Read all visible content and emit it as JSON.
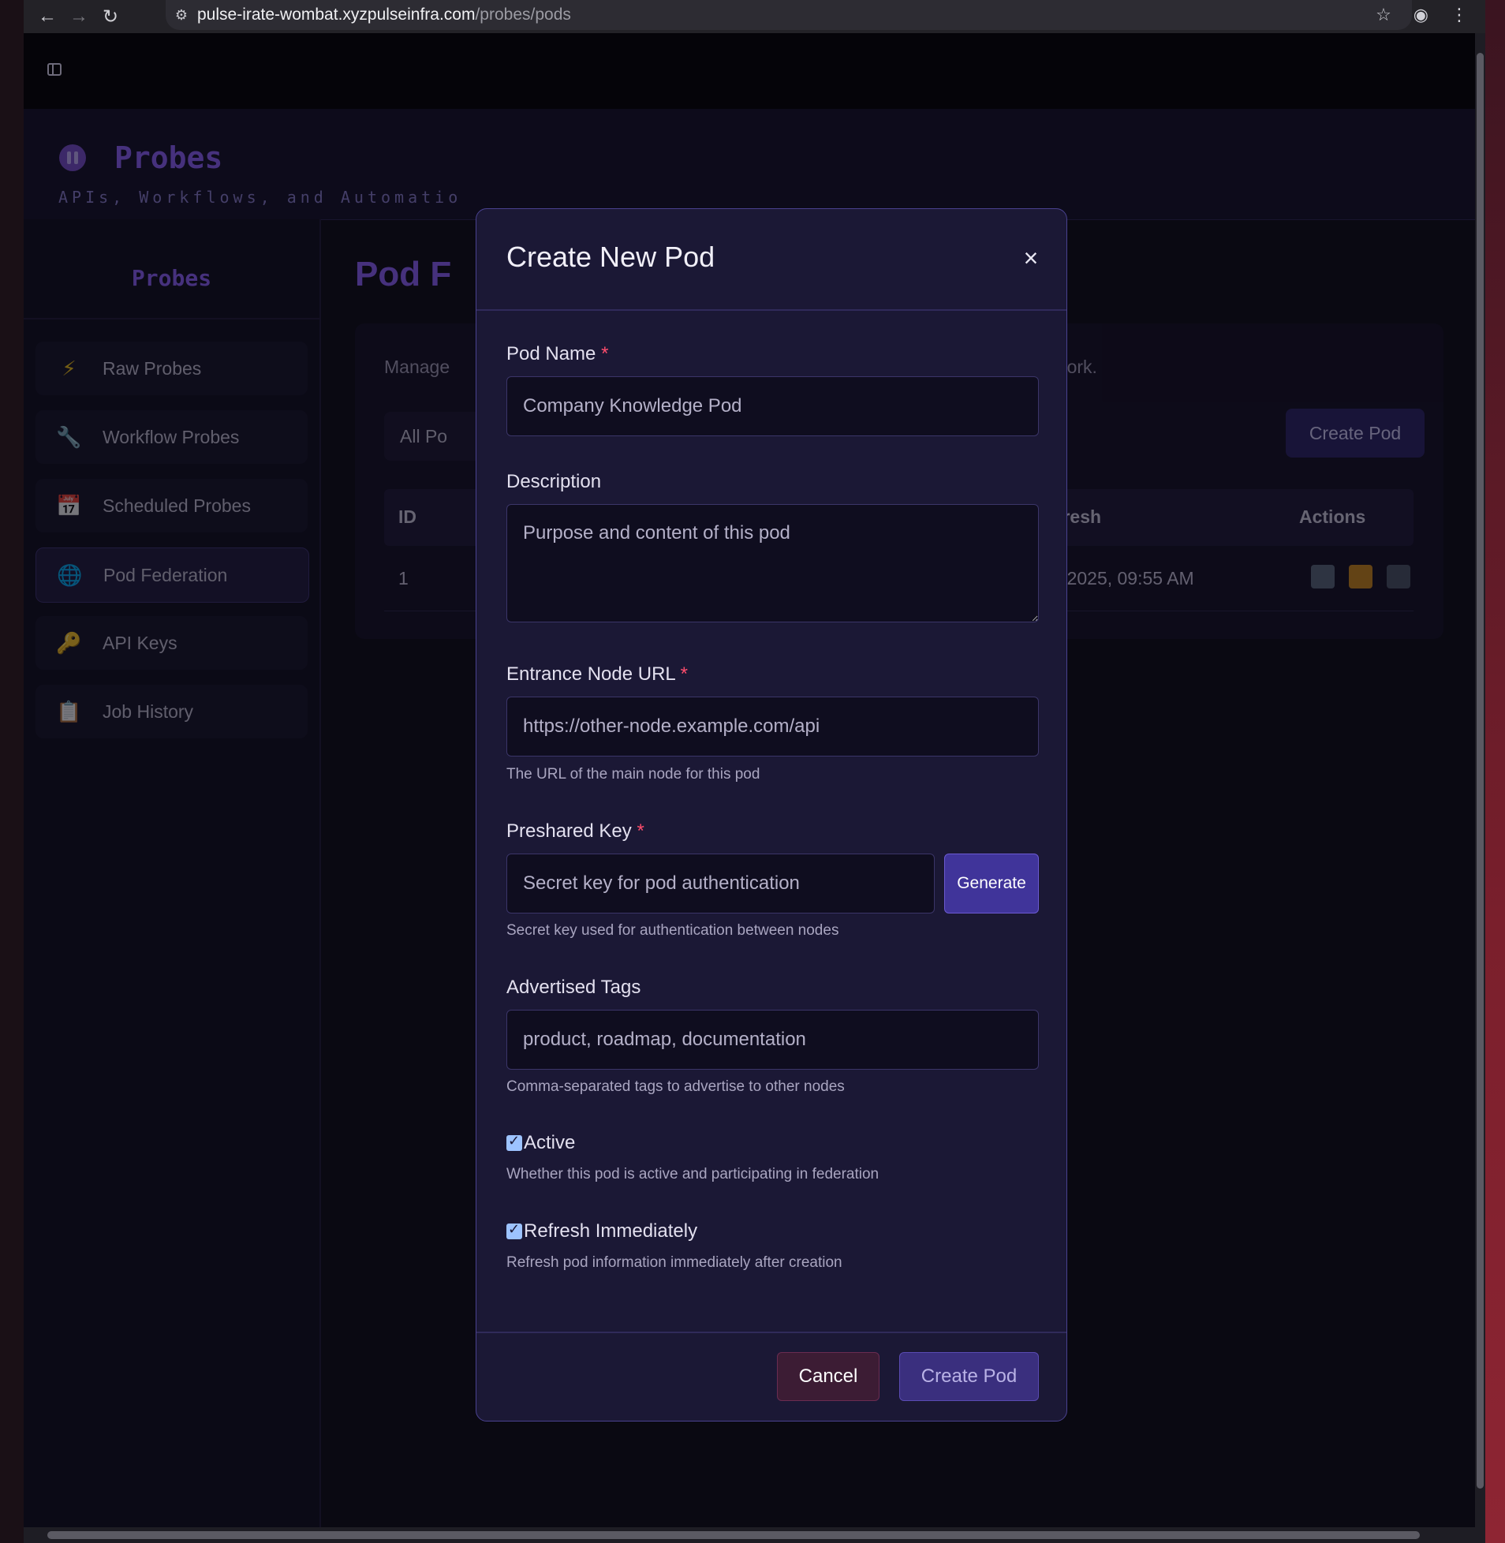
{
  "browser": {
    "url_host": "pulse-irate-wombat.xyzpulseinfra.com",
    "url_path": "/probes/pods"
  },
  "app": {
    "title": "Probes",
    "subtitle": "APIs, Workflows, and Automatio"
  },
  "sidebar": {
    "title": "Probes",
    "items": [
      {
        "label": "Raw Probes",
        "icon": "lightning-icon"
      },
      {
        "label": "Workflow Probes",
        "icon": "wrench-icon"
      },
      {
        "label": "Scheduled Probes",
        "icon": "calendar-icon"
      },
      {
        "label": "Pod Federation",
        "icon": "globe-icon",
        "active": true
      },
      {
        "label": "API Keys",
        "icon": "key-icon"
      },
      {
        "label": "Job History",
        "icon": "clipboard-icon"
      }
    ]
  },
  "main": {
    "title": "Pod F",
    "description_start": "Manage",
    "description_end": "work.",
    "filter_label": "All Po",
    "create_button": "Create Pod",
    "table": {
      "headers": {
        "id": "ID",
        "refresh": "efresh",
        "actions": "Actions"
      },
      "rows": [
        {
          "id": "1",
          "refresh": "5, 2025, 09:55 AM"
        }
      ]
    }
  },
  "modal": {
    "title": "Create New Pod",
    "close_symbol": "×",
    "pod_name": {
      "label": "Pod Name",
      "required_mark": "*",
      "placeholder": "Company Knowledge Pod"
    },
    "description": {
      "label": "Description",
      "placeholder": "Purpose and content of this pod"
    },
    "entrance_url": {
      "label": "Entrance Node URL",
      "required_mark": "*",
      "placeholder": "https://other-node.example.com/api",
      "hint": "The URL of the main node for this pod"
    },
    "preshared_key": {
      "label": "Preshared Key",
      "required_mark": "*",
      "placeholder": "Secret key for pod authentication",
      "generate_label": "Generate",
      "hint": "Secret key used for authentication between nodes"
    },
    "tags": {
      "label": "Advertised Tags",
      "placeholder": "product, roadmap, documentation",
      "hint": "Comma-separated tags to advertise to other nodes"
    },
    "active": {
      "label": "Active",
      "checked": true,
      "hint": "Whether this pod is active and participating in federation"
    },
    "refresh": {
      "label": "Refresh Immediately",
      "checked": true,
      "hint": "Refresh pod information immediately after creation"
    },
    "cancel_label": "Cancel",
    "create_label": "Create Pod"
  },
  "colors": {
    "accent": "#8f63ff",
    "modal_bg": "#1b1835",
    "required": "#ff4d6d",
    "cancel_bg": "#3c1c34",
    "primary_button": "#40349a"
  }
}
